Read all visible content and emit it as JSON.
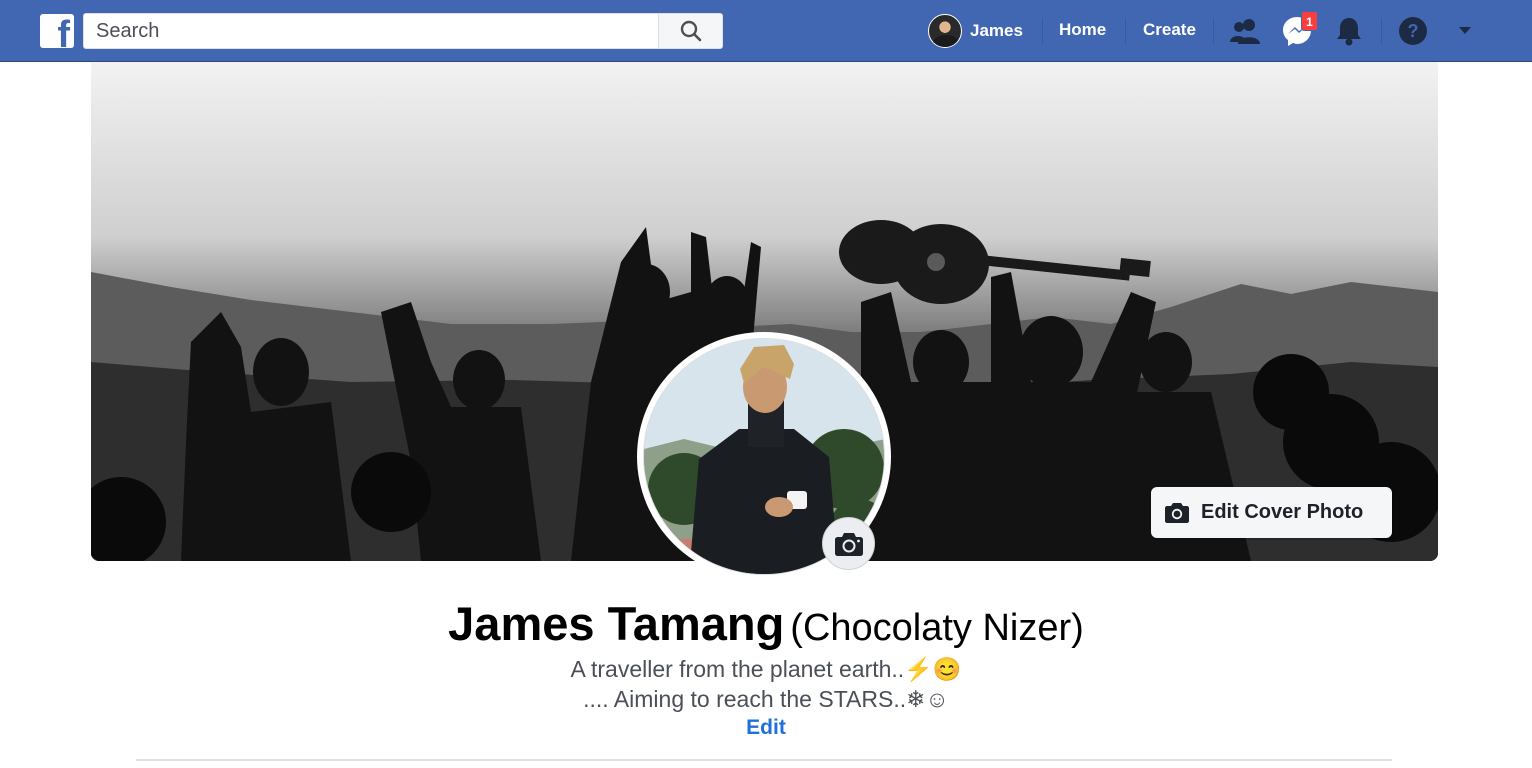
{
  "nav": {
    "logo": "f",
    "search_placeholder": "Search",
    "user_name": "James",
    "home_label": "Home",
    "create_label": "Create",
    "messenger_badge": "1",
    "icons": [
      "facebook-logo",
      "search-icon",
      "friends-icon",
      "messenger-icon",
      "bell-icon",
      "help-icon",
      "caret-down-icon"
    ],
    "bar_color": "#4267b2"
  },
  "cover": {
    "edit_label": "Edit Cover Photo"
  },
  "profile": {
    "name": "James Tamang",
    "alternate_name": "(Chocolaty Nizer)",
    "bio_line1": "A traveller from the planet earth..⚡😊",
    "bio_line2": ".... Aiming to reach the STARS..❄☺",
    "edit_label": "Edit"
  },
  "colors": {
    "link": "#216fdb",
    "badge": "#fa3e3e"
  }
}
